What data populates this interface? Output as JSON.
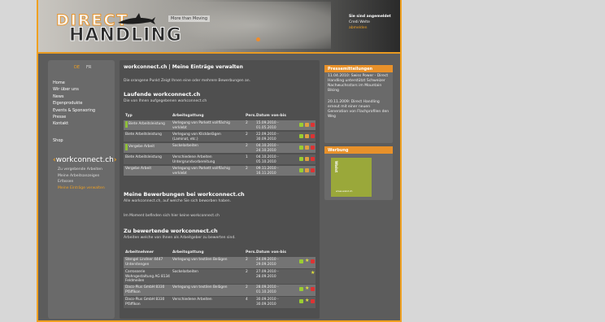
{
  "header": {
    "logo_line1": "DIRECT",
    "logo_line2": "HANDLING",
    "slogan": "More than Moving",
    "login_title": "Sie sind angemeldet",
    "login_user": "Credi Welte",
    "logout": "abmelden"
  },
  "leftnav": {
    "lang_de": "DE",
    "lang_fr": "FR",
    "items": [
      "Home",
      "Wir über uns",
      "News",
      "Eigenprodukte",
      "Events & Sponsoring",
      "Presse",
      "Kontakt"
    ],
    "shop": "Shop",
    "brand_pre": "workconnect",
    "brand_post": ".ch",
    "sub": [
      "Zu vergebende Arbeiten",
      "Meine Arbeitsanzeigen",
      "Erfassen",
      "Meine Einträge verwalten"
    ]
  },
  "main": {
    "title": "workconnect.ch | Meine Einträge verwalten",
    "intro": "Die orangene Punkt Zeigt Ihnen eine oder mehrere Bewerbungen an.",
    "section1": {
      "title": "Laufende workconnect.ch",
      "desc": "Die von Ihnen aufgegebenen workconnect.ch",
      "headers": [
        "Typ",
        "Arbeitsgattung",
        "Pers.",
        "Datum von-bis"
      ],
      "rows": [
        {
          "typ": "Biete Arbeitsleistung",
          "gattung": "Verlegung von Parkett vollflächig verklebt",
          "pers": "2",
          "datum": "15.09.2010 - 01.05.2010"
        },
        {
          "typ": "Biete Arbeitsleistung",
          "gattung": "Verlegung von Klickbelägen (Laminat, etc.)",
          "pers": "2",
          "datum": "22.09.2010 - 30.09.2010"
        },
        {
          "typ": "Vergebe Arbeit",
          "gattung": "Sockelarbeiten",
          "pers": "2",
          "datum": "04.10.2010 - 24.10.2010"
        },
        {
          "typ": "Biete Arbeitsleistung",
          "gattung": "Verschiedene Arbeiten Untergrundvorbereitung",
          "pers": "1",
          "datum": "04.10.2010 - 05.10.2010"
        },
        {
          "typ": "Vergebe Arbeit",
          "gattung": "Verlegung von Parkett vollflächig verklebt",
          "pers": "2",
          "datum": "09.11.2010 - 16.11.2010"
        }
      ]
    },
    "section2": {
      "title": "Meine Bewerbungen bei workconnect.ch",
      "desc": "Alle workconnect.ch, auf welche Sie sich beworben haben.",
      "empty": "Im Moment befinden sich hier keine workconnect.ch"
    },
    "section3": {
      "title": "Zu bewertende workconnect.ch",
      "desc": "Arbeiten welche von Ihnen als Arbeitgeber zu bewerten sind.",
      "headers": [
        "Arbeitnehmer",
        "Arbeitsgattung",
        "Pers.",
        "Datum von-bis"
      ],
      "rows": [
        {
          "name": "Stengel Lindner 4447 Unterstengen",
          "gattung": "Verlegung von textilen Belägen",
          "pers": "2",
          "datum": "24.09.2010 - 29.09.2010"
        },
        {
          "name": "Carrosserie Wohngestaltung AG 8134 Feldmeilen",
          "gattung": "Sockelarbeiten",
          "pers": "2",
          "datum": "27.09.2010 - 28.09.2010"
        },
        {
          "name": "Daco-Pius GmbH 8330 Pfäffikon",
          "gattung": "Verlegung von textilen Belägen",
          "pers": "2",
          "datum": "28.09.2010 - 01.10.2010"
        },
        {
          "name": "Daco-Pius GmbH 8330 Pfäffikon",
          "gattung": "Verschiedene Arbeiten",
          "pers": "4",
          "datum": "30.09.2010 - 30.09.2010"
        }
      ]
    }
  },
  "right": {
    "news_title": "Pressemitteilungen",
    "news": [
      "11.04.2010: Swiss Power - Direct Handling unterstützt Schweizer Nachwuchsstars im Mountain Biking",
      "20.11.2009: Direct Handling erneut mit einer neuen Generation von Flachprofilen den Weg"
    ],
    "ad_title": "Werbung",
    "ad_label": "Walst",
    "ad_small": "www.walst.ch"
  }
}
